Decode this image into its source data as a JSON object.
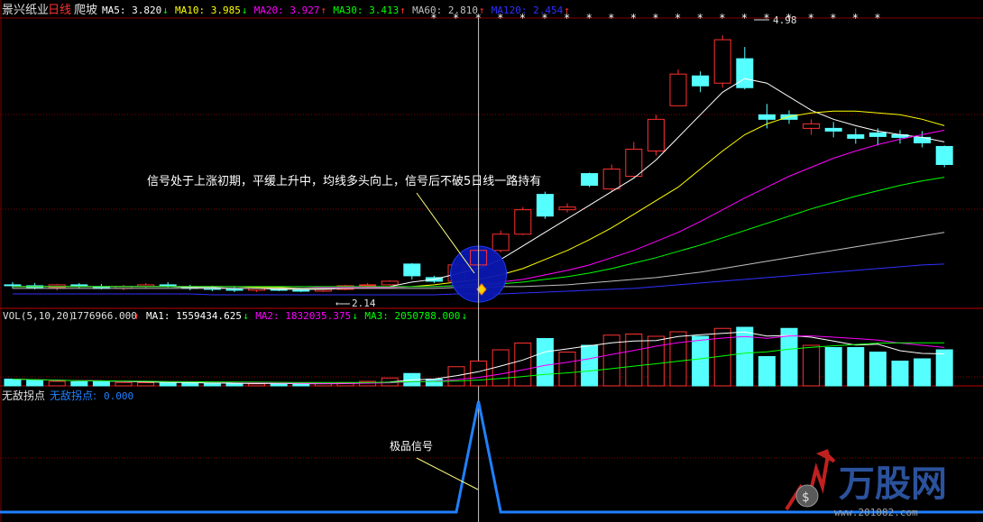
{
  "stock": {
    "name": "景兴纸业",
    "period": "日线",
    "pattern": "爬坡"
  },
  "ma_legend": [
    {
      "label": "MA5:",
      "value": "3.820",
      "arrow": "↓",
      "color": "#ffffff",
      "arrow_color": "#00ff00"
    },
    {
      "label": "MA10:",
      "value": "3.985",
      "arrow": "↓",
      "color": "#ffff00",
      "arrow_color": "#00ff00"
    },
    {
      "label": "MA20:",
      "value": "3.927",
      "arrow": "↑",
      "color": "#ff00ff",
      "arrow_color": "#ff3030"
    },
    {
      "label": "MA30:",
      "value": "3.413",
      "arrow": "↑",
      "color": "#00ff00",
      "arrow_color": "#ff3030"
    },
    {
      "label": "MA60:",
      "value": "2.810",
      "arrow": "↑",
      "color": "#c0c0c0",
      "arrow_color": "#ff3030"
    },
    {
      "label": "MA120:",
      "value": "2.454",
      "arrow": "↑",
      "color": "#3030ff",
      "arrow_color": "#ff3030"
    }
  ],
  "price_labels": {
    "high": "4.98",
    "low": "2.14"
  },
  "annotation_main": "信号处于上涨初期，平缓上升中，均线多头向上，信号后不破5日线一路持有",
  "vol_legend": {
    "title": "VOL(5,10,20)",
    "value": "1776966.000",
    "arrow": "↑",
    "items": [
      {
        "label": "MA1:",
        "value": "1559434.625",
        "arrow": "↓",
        "color": "#ffffff"
      },
      {
        "label": "MA2:",
        "value": "1832035.375",
        "arrow": "↓",
        "color": "#ff00ff"
      },
      {
        "label": "MA3:",
        "value": "2050788.000",
        "arrow": "↓",
        "color": "#00ff00"
      }
    ]
  },
  "indicator": {
    "title": "无敌拐点",
    "series_label": "无敌拐点:",
    "value": "0.000",
    "annotation": "极品信号"
  },
  "watermark": {
    "brand": "万股网",
    "url": "www.201082.com"
  },
  "colors": {
    "up": "#ff3030",
    "down": "#55ffff",
    "grid": "#800000",
    "ma5": "#ffffff",
    "ma10": "#ffff00",
    "ma20": "#ff00ff",
    "ma30": "#00ff00",
    "ma60": "#c0c0c0",
    "ma120": "#3030ff",
    "signal_circle": "#1020c0",
    "indicator_line": "#2080ff"
  },
  "chart_data": {
    "type": "candlestick",
    "price_range": [
      2.0,
      5.15
    ],
    "candles": [
      {
        "o": 2.22,
        "h": 2.25,
        "l": 2.18,
        "c": 2.21
      },
      {
        "o": 2.21,
        "h": 2.24,
        "l": 2.17,
        "c": 2.19
      },
      {
        "o": 2.19,
        "h": 2.23,
        "l": 2.16,
        "c": 2.22
      },
      {
        "o": 2.22,
        "h": 2.24,
        "l": 2.18,
        "c": 2.2
      },
      {
        "o": 2.2,
        "h": 2.23,
        "l": 2.17,
        "c": 2.18
      },
      {
        "o": 2.18,
        "h": 2.22,
        "l": 2.16,
        "c": 2.2
      },
      {
        "o": 2.2,
        "h": 2.24,
        "l": 2.18,
        "c": 2.22
      },
      {
        "o": 2.22,
        "h": 2.25,
        "l": 2.19,
        "c": 2.2
      },
      {
        "o": 2.2,
        "h": 2.22,
        "l": 2.16,
        "c": 2.18
      },
      {
        "o": 2.18,
        "h": 2.21,
        "l": 2.15,
        "c": 2.17
      },
      {
        "o": 2.17,
        "h": 2.2,
        "l": 2.14,
        "c": 2.16
      },
      {
        "o": 2.16,
        "h": 2.19,
        "l": 2.14,
        "c": 2.18
      },
      {
        "o": 2.18,
        "h": 2.2,
        "l": 2.15,
        "c": 2.16
      },
      {
        "o": 2.16,
        "h": 2.18,
        "l": 2.14,
        "c": 2.15
      },
      {
        "o": 2.15,
        "h": 2.18,
        "l": 2.14,
        "c": 2.17
      },
      {
        "o": 2.17,
        "h": 2.22,
        "l": 2.16,
        "c": 2.21
      },
      {
        "o": 2.21,
        "h": 2.24,
        "l": 2.19,
        "c": 2.22
      },
      {
        "o": 2.22,
        "h": 2.27,
        "l": 2.21,
        "c": 2.26
      },
      {
        "o": 2.45,
        "h": 2.46,
        "l": 2.28,
        "c": 2.32
      },
      {
        "o": 2.3,
        "h": 2.32,
        "l": 2.24,
        "c": 2.26
      },
      {
        "o": 2.26,
        "h": 2.46,
        "l": 2.26,
        "c": 2.44
      },
      {
        "o": 2.44,
        "h": 2.62,
        "l": 2.43,
        "c": 2.6
      },
      {
        "o": 2.6,
        "h": 2.82,
        "l": 2.58,
        "c": 2.78
      },
      {
        "o": 2.78,
        "h": 3.08,
        "l": 2.77,
        "c": 3.05
      },
      {
        "o": 3.22,
        "h": 3.25,
        "l": 2.95,
        "c": 2.98
      },
      {
        "o": 3.05,
        "h": 3.12,
        "l": 3.02,
        "c": 3.08
      },
      {
        "o": 3.45,
        "h": 3.46,
        "l": 3.3,
        "c": 3.32
      },
      {
        "o": 3.28,
        "h": 3.55,
        "l": 3.25,
        "c": 3.5
      },
      {
        "o": 3.42,
        "h": 3.8,
        "l": 3.4,
        "c": 3.72
      },
      {
        "o": 3.7,
        "h": 4.1,
        "l": 3.65,
        "c": 4.05
      },
      {
        "o": 4.2,
        "h": 4.6,
        "l": 4.2,
        "c": 4.55
      },
      {
        "o": 4.53,
        "h": 4.58,
        "l": 4.35,
        "c": 4.42
      },
      {
        "o": 4.45,
        "h": 4.98,
        "l": 4.4,
        "c": 4.93
      },
      {
        "o": 4.72,
        "h": 4.85,
        "l": 4.38,
        "c": 4.4
      },
      {
        "o": 4.1,
        "h": 4.22,
        "l": 3.95,
        "c": 4.05
      },
      {
        "o": 4.1,
        "h": 4.15,
        "l": 4.0,
        "c": 4.05
      },
      {
        "o": 3.95,
        "h": 4.05,
        "l": 3.88,
        "c": 4.0
      },
      {
        "o": 3.95,
        "h": 4.02,
        "l": 3.85,
        "c": 3.92
      },
      {
        "o": 3.88,
        "h": 3.95,
        "l": 3.78,
        "c": 3.84
      },
      {
        "o": 3.9,
        "h": 3.95,
        "l": 3.76,
        "c": 3.86
      },
      {
        "o": 3.88,
        "h": 3.93,
        "l": 3.78,
        "c": 3.85
      },
      {
        "o": 3.85,
        "h": 3.92,
        "l": 3.74,
        "c": 3.79
      },
      {
        "o": 3.75,
        "h": 3.76,
        "l": 3.52,
        "c": 3.55
      }
    ],
    "ma_lines": {
      "ma5": [
        2.2,
        2.2,
        2.2,
        2.2,
        2.2,
        2.2,
        2.2,
        2.2,
        2.19,
        2.19,
        2.18,
        2.18,
        2.17,
        2.17,
        2.17,
        2.18,
        2.19,
        2.2,
        2.25,
        2.28,
        2.34,
        2.4,
        2.5,
        2.65,
        2.8,
        2.95,
        3.1,
        3.25,
        3.4,
        3.6,
        3.85,
        4.1,
        4.35,
        4.5,
        4.45,
        4.3,
        4.15,
        4.05,
        3.98,
        3.92,
        3.88,
        3.85,
        3.8
      ],
      "ma10": [
        2.2,
        2.2,
        2.2,
        2.2,
        2.2,
        2.2,
        2.2,
        2.2,
        2.2,
        2.2,
        2.2,
        2.19,
        2.19,
        2.18,
        2.18,
        2.18,
        2.19,
        2.19,
        2.2,
        2.22,
        2.25,
        2.28,
        2.33,
        2.4,
        2.5,
        2.6,
        2.72,
        2.85,
        3.0,
        3.15,
        3.3,
        3.5,
        3.7,
        3.88,
        4.0,
        4.08,
        4.12,
        4.14,
        4.14,
        4.12,
        4.1,
        4.05,
        3.98
      ],
      "ma20": [
        2.2,
        2.2,
        2.2,
        2.2,
        2.2,
        2.2,
        2.2,
        2.2,
        2.2,
        2.2,
        2.2,
        2.2,
        2.2,
        2.2,
        2.19,
        2.19,
        2.19,
        2.19,
        2.2,
        2.2,
        2.21,
        2.23,
        2.25,
        2.28,
        2.33,
        2.38,
        2.44,
        2.52,
        2.6,
        2.7,
        2.8,
        2.92,
        3.05,
        3.18,
        3.3,
        3.42,
        3.52,
        3.62,
        3.7,
        3.77,
        3.83,
        3.88,
        3.93
      ],
      "ma30": [
        2.2,
        2.2,
        2.2,
        2.2,
        2.2,
        2.2,
        2.2,
        2.2,
        2.2,
        2.2,
        2.2,
        2.2,
        2.2,
        2.2,
        2.2,
        2.2,
        2.2,
        2.2,
        2.2,
        2.2,
        2.21,
        2.22,
        2.23,
        2.25,
        2.28,
        2.31,
        2.35,
        2.4,
        2.46,
        2.52,
        2.59,
        2.66,
        2.74,
        2.82,
        2.9,
        2.98,
        3.06,
        3.13,
        3.2,
        3.26,
        3.32,
        3.37,
        3.41
      ],
      "ma60": [
        2.18,
        2.18,
        2.18,
        2.18,
        2.18,
        2.18,
        2.18,
        2.18,
        2.18,
        2.18,
        2.18,
        2.18,
        2.18,
        2.18,
        2.18,
        2.18,
        2.18,
        2.18,
        2.18,
        2.18,
        2.19,
        2.19,
        2.2,
        2.2,
        2.21,
        2.22,
        2.24,
        2.26,
        2.28,
        2.3,
        2.33,
        2.36,
        2.4,
        2.44,
        2.48,
        2.52,
        2.56,
        2.6,
        2.64,
        2.68,
        2.72,
        2.76,
        2.8
      ],
      "ma120": [
        2.12,
        2.12,
        2.12,
        2.12,
        2.12,
        2.12,
        2.12,
        2.12,
        2.12,
        2.11,
        2.11,
        2.11,
        2.11,
        2.11,
        2.11,
        2.11,
        2.11,
        2.11,
        2.11,
        2.11,
        2.12,
        2.12,
        2.12,
        2.13,
        2.14,
        2.15,
        2.16,
        2.17,
        2.18,
        2.2,
        2.22,
        2.24,
        2.26,
        2.28,
        2.3,
        2.32,
        2.34,
        2.36,
        2.38,
        2.4,
        2.42,
        2.44,
        2.45
      ]
    },
    "volume": [
      0.3,
      0.25,
      0.2,
      0.18,
      0.2,
      0.15,
      0.14,
      0.12,
      0.12,
      0.1,
      0.1,
      0.09,
      0.1,
      0.09,
      0.1,
      0.12,
      0.2,
      0.35,
      0.55,
      0.3,
      0.85,
      1.1,
      1.6,
      1.9,
      2.1,
      1.5,
      1.8,
      2.25,
      2.3,
      2.2,
      2.4,
      2.2,
      2.55,
      2.6,
      1.3,
      2.55,
      1.8,
      1.7,
      1.7,
      1.5,
      1.1,
      1.2,
      1.6
    ],
    "volume_range": [
      0,
      2.8
    ],
    "signal_index": 21,
    "indicator_values": [
      0,
      0,
      0,
      0,
      0,
      0,
      0,
      0,
      0,
      0,
      0,
      0,
      0,
      0,
      0,
      0,
      0,
      0,
      0,
      0,
      0,
      100,
      0,
      0,
      0,
      0,
      0,
      0,
      0,
      0,
      0,
      0,
      0,
      0,
      0,
      0,
      0,
      0,
      0,
      0,
      0,
      0,
      0
    ]
  }
}
